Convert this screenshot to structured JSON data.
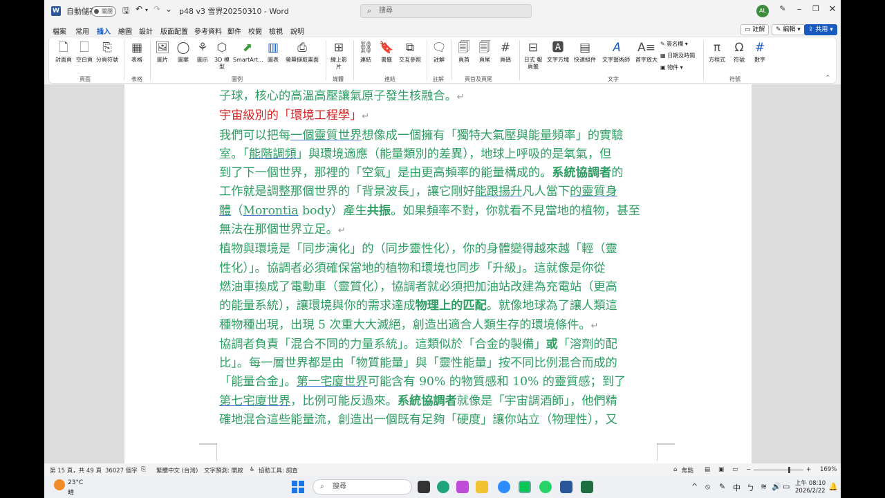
{
  "titlebar": {
    "autosave_label": "自動儲存",
    "autosave_state": "關閉",
    "doc_title": "p48 v3 雪界20250310 - Word",
    "search_placeholder": "搜尋",
    "user_initials": "AL"
  },
  "menu": {
    "tabs": [
      "檔案",
      "常用",
      "插入",
      "繪圖",
      "設計",
      "版面配置",
      "參考資料",
      "郵件",
      "校閱",
      "檢視",
      "說明"
    ],
    "active_tab": "插入",
    "comments_button": "註解",
    "editing_button": "編輯",
    "share_button": "共用"
  },
  "ribbon": {
    "items": {
      "cover_page": "封面頁",
      "blank_page": "空白頁",
      "page_break": "分頁符號",
      "table": "表格",
      "pictures": "圖片",
      "shapes": "圖案",
      "icons": "圖示",
      "models_3d": "3D 模型",
      "smartart": "SmartArt...",
      "chart": "圖表",
      "screenshot": "螢幕擷取畫面",
      "online_video": "線上影片",
      "link": "連結",
      "bookmark": "書籤",
      "cross_reference": "交互參照",
      "comment": "註解",
      "header": "頁首",
      "footer": "頁尾",
      "page_number": "頁碼",
      "quick_parts": "日式 報頁籤",
      "text_box": "文字方塊",
      "quick_components": "快速組件",
      "wordart": "文字藝術師",
      "drop_cap": "首字放大",
      "signature_line": "簽名欄",
      "date_time": "日期及時間",
      "object": "物件",
      "equation": "方程式",
      "symbol": "符號",
      "number": "數字"
    },
    "groups": {
      "pages": "頁面",
      "tables": "表格",
      "illustrations": "圖例",
      "media": "媒體",
      "links": "連結",
      "comments": "註解",
      "header_footer": "頁首及頁尾",
      "text": "文字",
      "symbols": "符號"
    }
  },
  "document": {
    "lines": {
      "l1": "子球，核心的高溫高壓讓氣原子發生核融合。",
      "heading": "宇宙級別的「環境工程學」",
      "p1_1a": "我們可以把每",
      "p1_1u": "一個靈質世界",
      "p1_1b": "想像成一個擁有「獨特大氣壓與能量頻率」的實驗",
      "p1_2a": "室。「",
      "p1_2u": "能階調頻",
      "p1_2b": "」與環境適應（能量類別的差異），地球上呼吸的是氧氣，但",
      "p1_3a": "到了下一個世界，那裡的「空氣」是由更高頻率的能量構成的。",
      "p1_3b": "系統協調者",
      "p1_3c": "的",
      "p1_4a": "工作就是調整那個世界的「背景波長」，讓它剛好",
      "p1_4u": "能跟揚升",
      "p1_4b": "凡人當下",
      "p1_4u2": "的靈質身",
      "p1_5u": "體",
      "p1_5a": "（",
      "p1_5u2": "Morontia",
      "p1_5b": " body）產生",
      "p1_5c": "共振",
      "p1_5d": "。如果頻率不對，你就看不見當地的植物，甚至",
      "p1_6": "無法在那個世界立足。",
      "p2_1": "植物與環境是「同步演化」的（同步靈性化），你的身體變得越來越「輕（靈",
      "p2_2": "性化）」。協調者必須確保當地的植物和環境也同步「升級」。這就像是你從",
      "p2_3": "燃油車換成了電動車（靈質化），協調者就必須把加油站改建為充電站（更高",
      "p2_4a": "的能量系統），讓環境與你的需求達成",
      "p2_4b": "物理上的匹配",
      "p2_4c": "。就像地球為了讓人類這",
      "p2_5": "種物種出現，出現 5 次重大大滅絕，創造出適合人類生存的環境條件。",
      "p3_1a": "協調者負責「混合不同的力量系統」。這類似於「合金的製備」",
      "p3_1b": "或",
      "p3_1c": "「溶劑的配",
      "p3_2": "比」。每一層世界都是由「物質能量」與「靈性能量」按不同比例混合而成的",
      "p3_3a": "「能量合金」。",
      "p3_3u": "第一宅廈世界",
      "p3_3b": "可能含有 90% 的物質感和 10% 的靈質感；到了",
      "p3_4u": "第七宅廈世界",
      "p3_4a": "，比例可能反過來。",
      "p3_4b": "系統協調者",
      "p3_4c": "就像是「宇宙調酒師」，他們精",
      "p3_5": "確地混合這些能量流，創造出一個既有足夠「硬度」讓你站立（物理性），又"
    },
    "colors": {
      "body_text": "#2e9e63",
      "heading": "#d62828",
      "underline": "#4a7ccf"
    }
  },
  "statusbar": {
    "page_info": "第 15 頁，共 49 頁",
    "word_count": "36027 個字",
    "language": "繁體中文 (台灣)",
    "text_prediction": "文字預測: 開啟",
    "accessibility": "協助工具: 調查",
    "focus": "焦點",
    "zoom": "169%"
  },
  "taskbar": {
    "weather_temp": "23°C",
    "weather_desc": "晴",
    "search_placeholder": "搜尋",
    "ime_lang": "中",
    "time": "上午 08:10",
    "date": "2026/2/22"
  }
}
